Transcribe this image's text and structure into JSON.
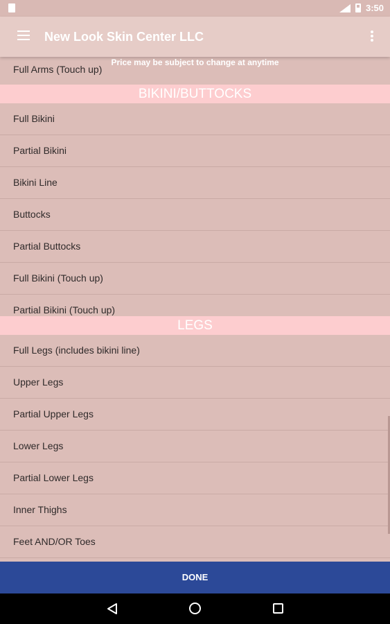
{
  "status_bar": {
    "time": "3:50"
  },
  "toolbar": {
    "title": "New Look Skin Center LLC"
  },
  "notice": "Price may be subject to change at anytime",
  "list": {
    "partial_item": "Full Arms (Touch up)",
    "sections": [
      {
        "header": "BIKINI/BUTTOCKS",
        "items": [
          "Full Bikini",
          "Partial Bikini",
          "Bikini Line",
          "Buttocks",
          "Partial Buttocks",
          "Full Bikini (Touch up)",
          "Partial Bikini (Touch up)"
        ]
      },
      {
        "header": "LEGS",
        "items": [
          "Full Legs (includes bikini line)",
          "Upper Legs",
          "Partial Upper Legs",
          "Lower Legs",
          "Partial Lower Legs",
          "Inner Thighs",
          "Feet AND/OR Toes"
        ]
      }
    ]
  },
  "done_label": "DONE"
}
